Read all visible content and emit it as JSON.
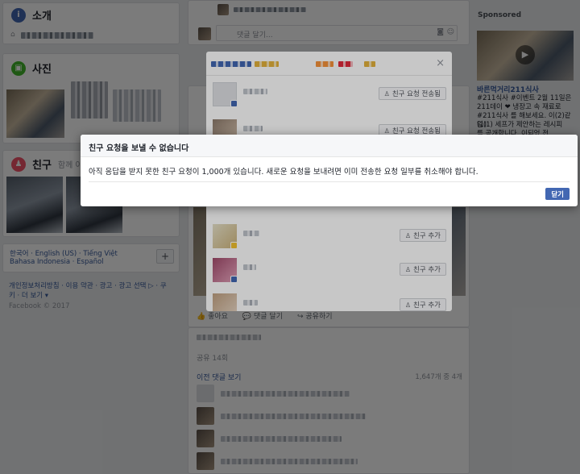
{
  "left": {
    "about": {
      "title": "소개"
    },
    "photos": {
      "title": "사진"
    },
    "friends": {
      "title": "친구",
      "subtitle": "함께 아는"
    },
    "languages": {
      "line1": "한국어 · English (US) · Tiếng Việt",
      "line2": "Bahasa Indonesia · Español",
      "add_label": "+"
    },
    "footer": {
      "line1": "개인정보처리방침 · 이용 약관 · 광고 · 광고 선택 ▷ · 쿠",
      "line2": "키 · 더 보기 ▾",
      "copyright": "Facebook © 2017"
    }
  },
  "middle": {
    "comment_placeholder": "댓글 달기...",
    "actions": {
      "like": "좋아요",
      "comment": "댓글 달기",
      "share": "공유하기"
    },
    "share_count": "공유 14회",
    "prev_comments": "이전 댓글 보기",
    "comment_count": "1,647개 중 4개"
  },
  "right": {
    "sponsored": "Sponsored",
    "ad_title": "바른먹거리211식사",
    "ad_lines": [
      "#211식사 #이벤트 2월 11일은",
      "211데이 ❤ 냉장고 속 재료로",
      "#211식사 를 해보세요. 이(2)같(1)",
      "일(1) 세프가 제안하는 레시피",
      "를 공개합니다. 이되었 전"
    ]
  },
  "friend_dialog": {
    "close_label": "×",
    "rows": [
      {
        "name_visible": true,
        "button": "친구 요청 전송됨"
      },
      {
        "name_visible": true,
        "button": "친구 요청 전송됨"
      },
      {
        "name_visible": true,
        "button": "친구 추가"
      },
      {
        "name_visible": true,
        "button": "친구 추가"
      },
      {
        "name_visible": true,
        "button": "친구 추가"
      }
    ]
  },
  "alert": {
    "title": "친구 요청을 보낼 수 없습니다",
    "message": "아직 응답을 받지 못한 친구 요청이 1,000개 있습니다. 새로운 요청을 보내려면 이미 전송한 요청 일부를 취소해야 합니다.",
    "close_button": "닫기"
  },
  "colors": {
    "brand": "#4267b2",
    "link": "#365899",
    "bg": "#e9ebee"
  }
}
